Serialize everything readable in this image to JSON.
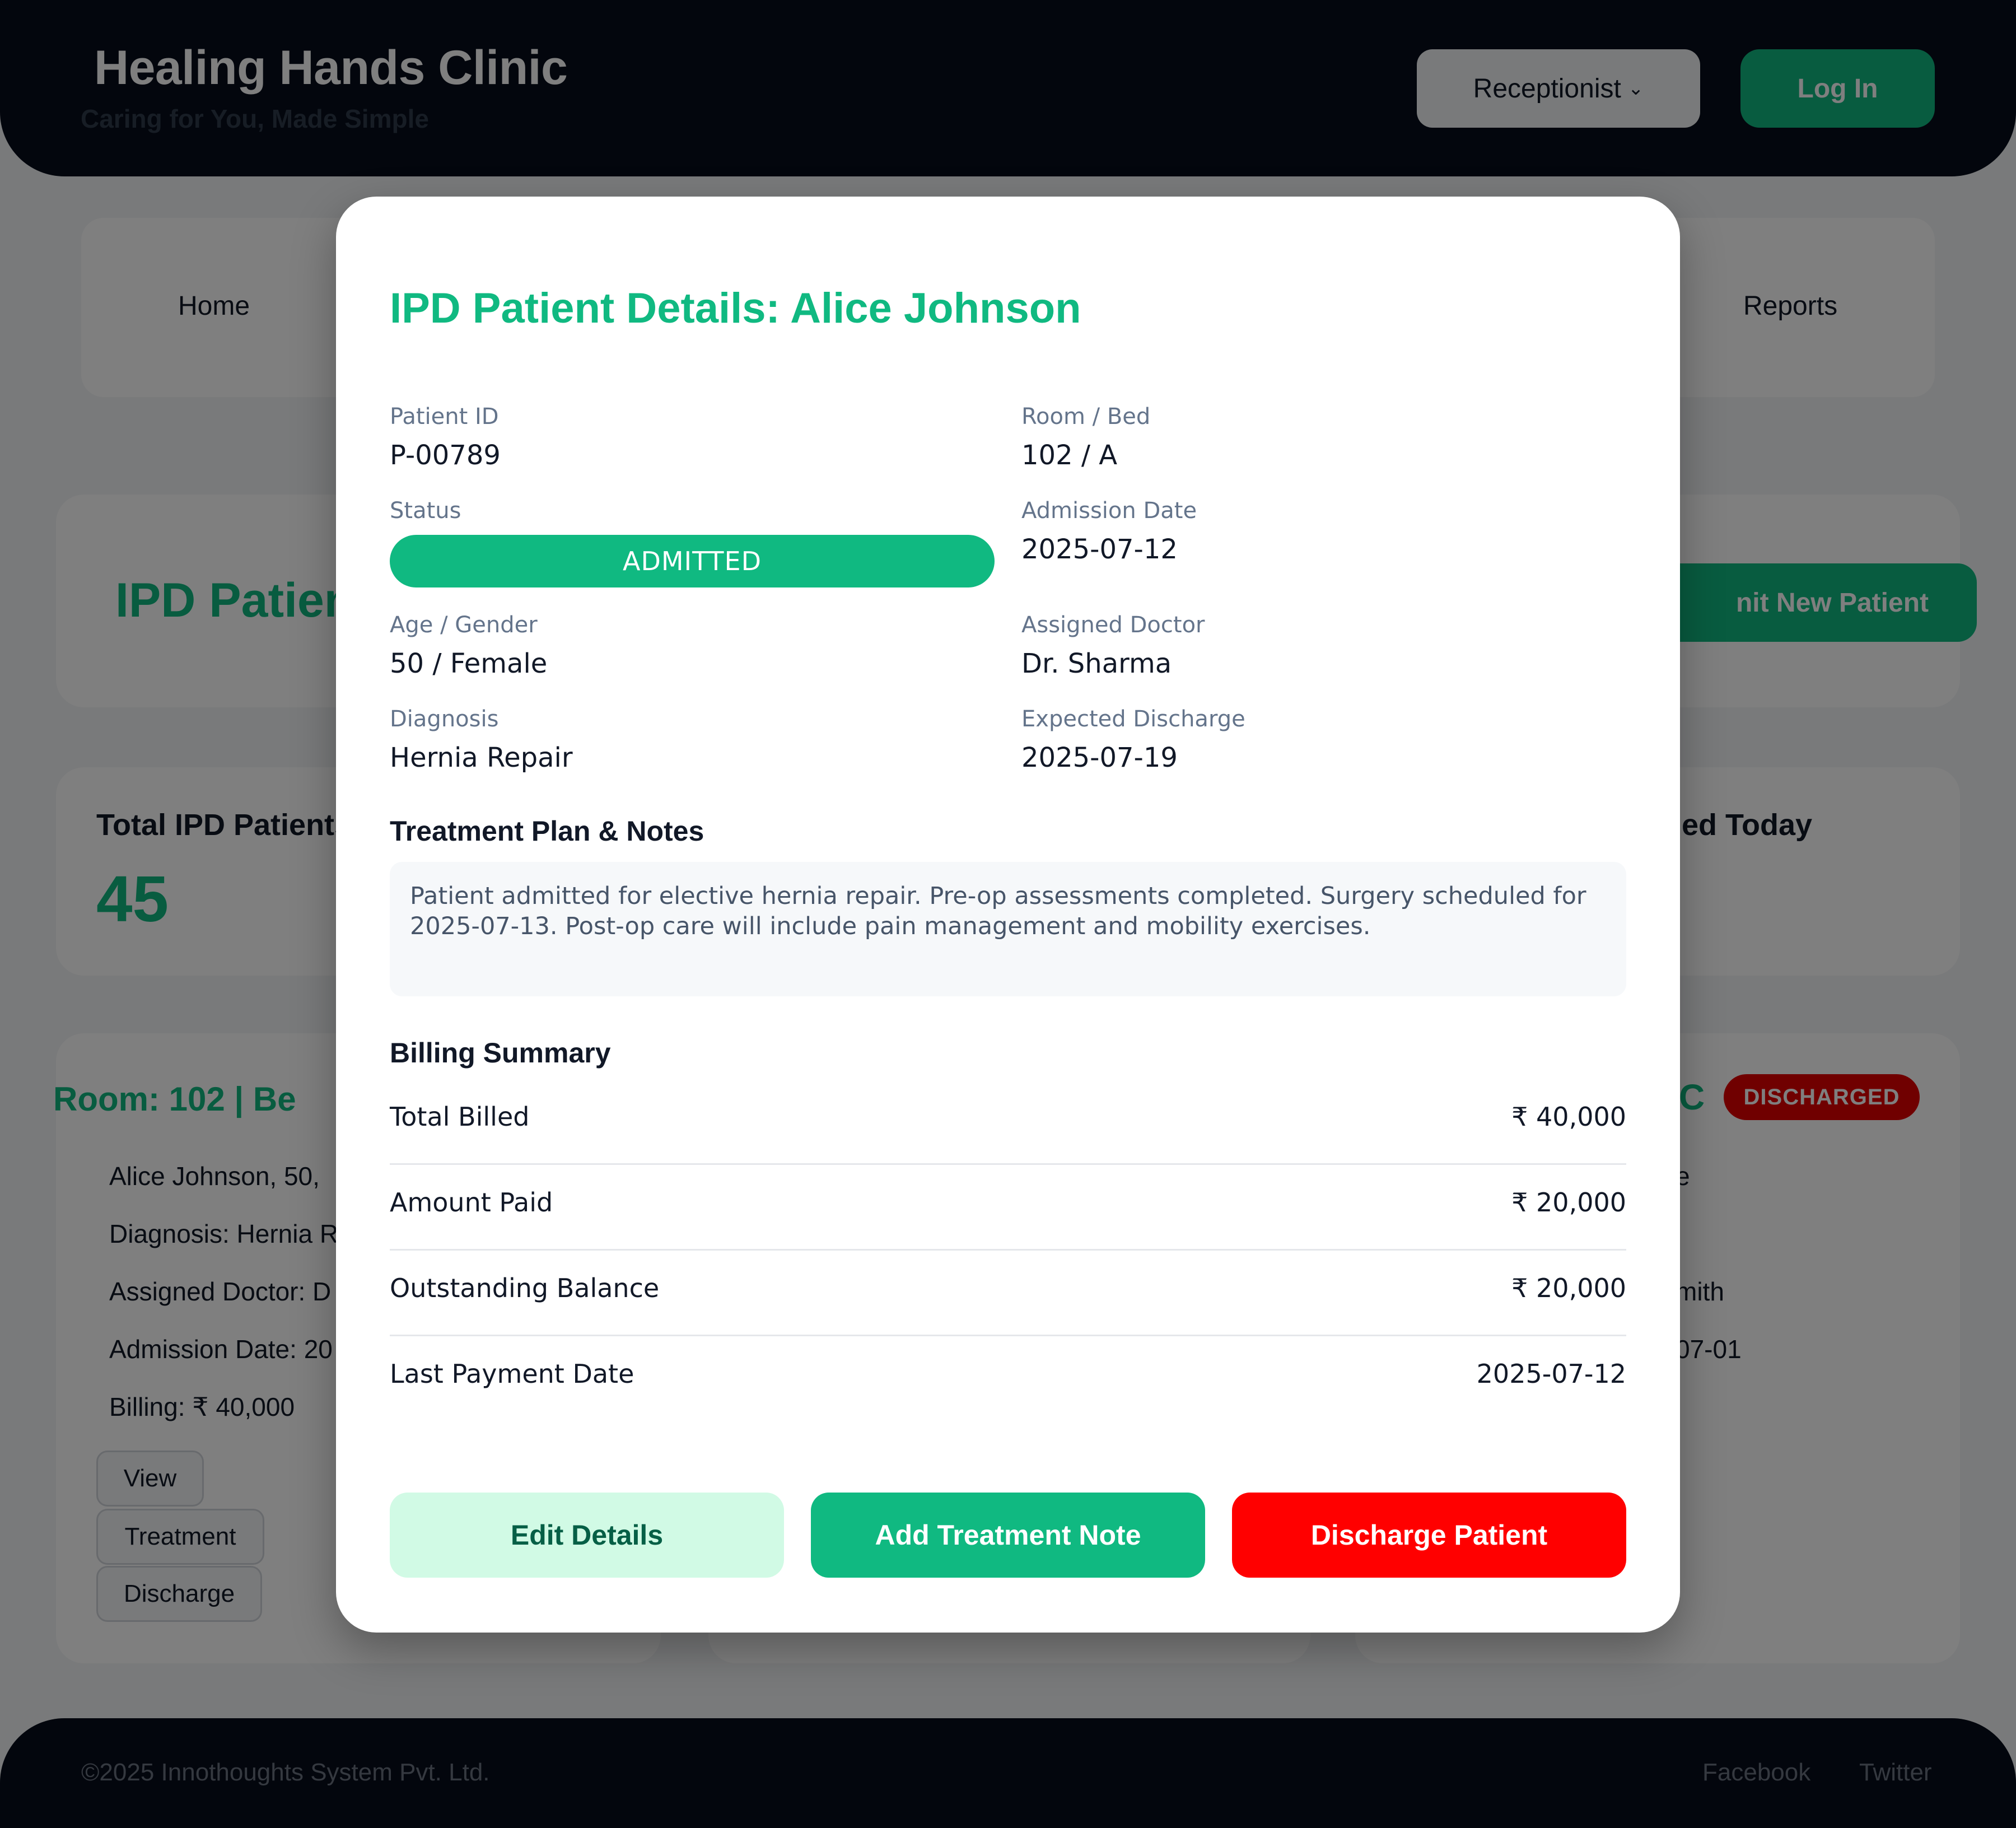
{
  "header": {
    "title": "Healing Hands Clinic",
    "tagline": "Caring for You, Made Simple",
    "role_selected": "Receptionist",
    "login_label": "Log In"
  },
  "nav": {
    "items": [
      "Home",
      "Reports"
    ]
  },
  "page": {
    "title_fragment": "IPD Patien",
    "admit_fragment": "nit New Patient"
  },
  "stats": {
    "total_label_fragment": "Total IPD Patients",
    "total_value": "45",
    "discharged_label_fragment": "ged Today"
  },
  "room_card": {
    "title_fragment": "Room: 102 | Be",
    "lines": [
      "Alice Johnson, 50,",
      "Diagnosis: Hernia R",
      "Assigned Doctor: D",
      "Admission Date: 20",
      "Billing: ₹ 40,000"
    ],
    "buttons": [
      "View",
      "Treatment",
      "Discharge"
    ]
  },
  "room_card_right": {
    "title_fragment": "C",
    "badge": "DISCHARGED",
    "fragments": [
      "e",
      "mith",
      "07-01"
    ]
  },
  "footer": {
    "copyright": "©2025 Innothoughts System Pvt. Ltd.",
    "links": [
      "Facebook",
      "Twitter"
    ]
  },
  "modal": {
    "title": "IPD Patient Details: Alice Johnson",
    "fields": {
      "patient_id_label": "Patient ID",
      "patient_id": "P-00789",
      "room_bed_label": "Room / Bed",
      "room_bed": "102 / A",
      "status_label": "Status",
      "status": "ADMITTED",
      "admission_date_label": "Admission Date",
      "admission_date": "2025-07-12",
      "age_gender_label": "Age / Gender",
      "age_gender": "50 / Female",
      "doctor_label": "Assigned Doctor",
      "doctor": "Dr. Sharma",
      "diagnosis_label": "Diagnosis",
      "diagnosis": "Hernia Repair",
      "expected_discharge_label": "Expected Discharge",
      "expected_discharge": "2025-07-19"
    },
    "notes_heading": "Treatment Plan & Notes",
    "notes": "Patient admitted for elective hernia repair. Pre-op assessments completed. Surgery scheduled for 2025-07-13. Post-op care will include pain management and mobility exercises.",
    "billing_heading": "Billing Summary",
    "billing": [
      {
        "label": "Total Billed",
        "value": "₹ 40,000"
      },
      {
        "label": "Amount Paid",
        "value": "₹ 20,000"
      },
      {
        "label": "Outstanding Balance",
        "value": "₹ 20,000"
      },
      {
        "label": "Last Payment Date",
        "value": "2025-07-12"
      }
    ],
    "buttons": {
      "edit": "Edit Details",
      "add_note": "Add Treatment Note",
      "discharge": "Discharge Patient"
    }
  },
  "colors": {
    "accent": "#10b981",
    "header_bg": "#070d1a",
    "danger": "#ff0000",
    "edit_bg": "#d1fae5"
  }
}
